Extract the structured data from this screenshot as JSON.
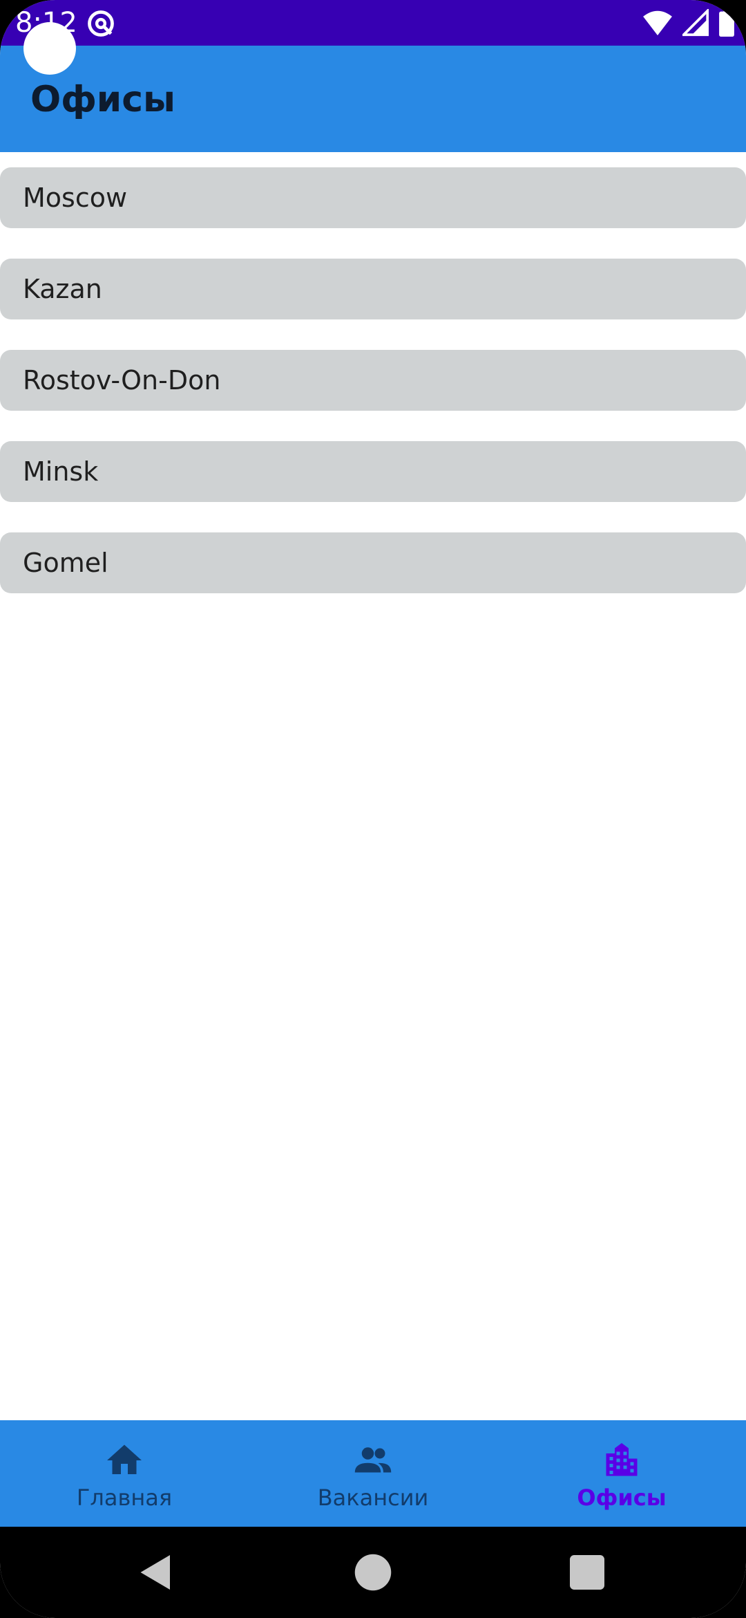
{
  "status_bar": {
    "time": "8:12",
    "app_icon": "at-sign-icon",
    "wifi_icon": "wifi-icon",
    "signal_icon": "signal-icon",
    "battery_icon": "battery-icon",
    "color": "#3700b3"
  },
  "app_bar": {
    "title": "Офисы",
    "color": "#2989e4"
  },
  "offices": [
    {
      "name": "Moscow"
    },
    {
      "name": "Kazan"
    },
    {
      "name": "Rostov-On-Don"
    },
    {
      "name": "Minsk"
    },
    {
      "name": "Gomel"
    }
  ],
  "bottom_nav": {
    "items": [
      {
        "label": "Главная",
        "icon": "home-icon",
        "active": false
      },
      {
        "label": "Вакансии",
        "icon": "people-icon",
        "active": false
      },
      {
        "label": "Офисы",
        "icon": "building-icon",
        "active": true
      }
    ],
    "active_color": "#5a00e6",
    "inactive_color": "#123c6b"
  },
  "system_nav": {
    "back_icon": "back-triangle-icon",
    "home_icon": "home-circle-icon",
    "recents_icon": "recents-square-icon"
  }
}
